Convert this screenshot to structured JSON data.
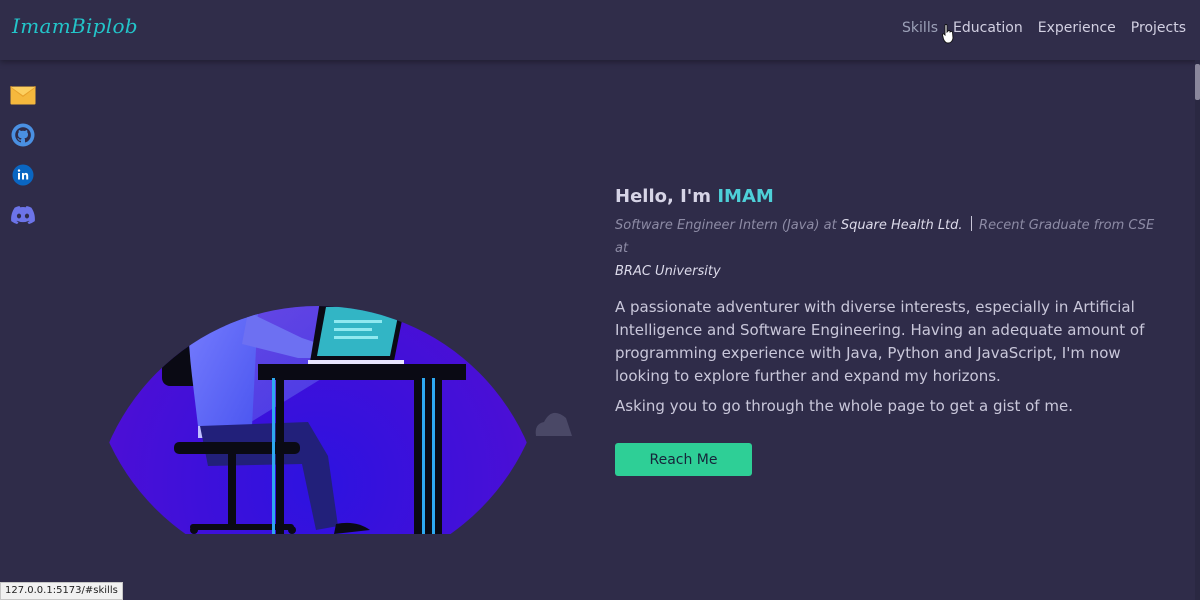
{
  "navbar": {
    "brand": "ImamBiplob",
    "links": [
      {
        "label": "Skills"
      },
      {
        "label": "Education"
      },
      {
        "label": "Experience"
      },
      {
        "label": "Projects"
      }
    ]
  },
  "social": [
    {
      "icon": "mail-icon"
    },
    {
      "icon": "github-icon"
    },
    {
      "icon": "linkedin-icon"
    },
    {
      "icon": "discord-icon"
    }
  ],
  "hero": {
    "greeting": "Hello, I'm",
    "name": "IMAM",
    "role_prefix": "Software Engineer Intern (Java) at",
    "company": "Square Health Ltd.",
    "grad_prefix": "Recent Graduate from CSE at",
    "university": "BRAC University",
    "bio": "A passionate adventurer with diverse interests, especially in Artificial Intelligence and Software Engineering. Having an adequate amount of programming experience with Java, Python and JavaScript, I'm now looking to explore further and expand my horizons.",
    "bio2": "Asking you to go through the whole page to get a gist of me.",
    "cta": "Reach Me"
  },
  "status_url": "127.0.0.1:5173/#skills",
  "colors": {
    "background": "#2f2c49",
    "accent": "#4ed0d8",
    "brand": "#23c4c9",
    "button": "#2ecf96"
  }
}
